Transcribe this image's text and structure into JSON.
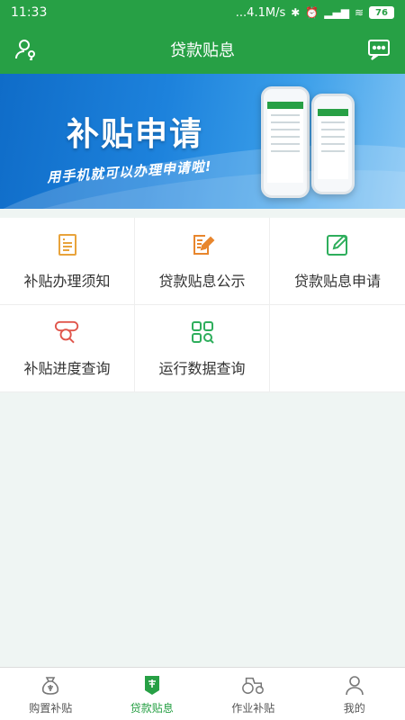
{
  "status_bar": {
    "time": "11:33",
    "network_speed": "...4.1M/s",
    "battery": "76"
  },
  "header": {
    "title": "贷款贴息",
    "left_icon": "user-key-icon",
    "right_icon": "message-icon"
  },
  "banner": {
    "title": "补贴申请",
    "subtitle": "用手机就可以办理申请啦!"
  },
  "menu": [
    {
      "label": "补贴办理须知",
      "icon": "notice-list-icon",
      "color": "#e8a33b"
    },
    {
      "label": "贷款贴息公示",
      "icon": "edit-document-icon",
      "color": "#e8862d"
    },
    {
      "label": "贷款贴息申请",
      "icon": "edit-square-icon",
      "color": "#2eae5c"
    },
    {
      "label": "补贴进度查询",
      "icon": "progress-search-icon",
      "color": "#e0554b"
    },
    {
      "label": "运行数据查询",
      "icon": "data-grid-search-icon",
      "color": "#2eae5c"
    }
  ],
  "tabs": [
    {
      "label": "购置补贴",
      "icon": "money-bag-icon",
      "active": false
    },
    {
      "label": "贷款贴息",
      "icon": "loan-icon",
      "active": true
    },
    {
      "label": "作业补贴",
      "icon": "tractor-icon",
      "active": false
    },
    {
      "label": "我的",
      "icon": "profile-icon",
      "active": false
    }
  ],
  "colors": {
    "primary": "#27a045",
    "background": "#eff5f3",
    "banner_blue": "#1d82dc"
  }
}
